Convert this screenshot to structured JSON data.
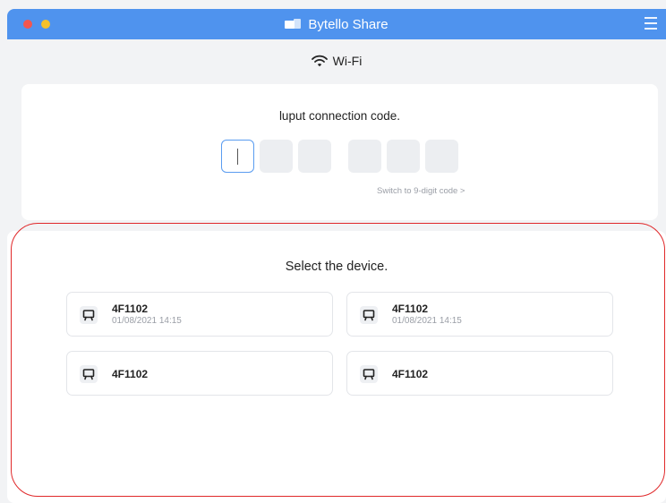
{
  "titlebar": {
    "app_name": "Bytello Share"
  },
  "network": {
    "label": "Wi-Fi"
  },
  "connection_code": {
    "title": "luput connection code.",
    "switch_link": "Switch to 9-digit code >"
  },
  "device_section": {
    "title": "Select the device.",
    "devices": [
      {
        "name": "4F1102",
        "time": "01/08/2021 14:15"
      },
      {
        "name": "4F1102",
        "time": "01/08/2021 14:15"
      },
      {
        "name": "4F1102"
      },
      {
        "name": "4F1102"
      }
    ]
  },
  "colors": {
    "titlebar": "#4f93ee",
    "highlight": "#e0282a",
    "active_input_border": "#5a9cf0"
  },
  "icons": [
    "app-logo-icon",
    "menu-icon",
    "wifi-icon",
    "device-icon"
  ]
}
